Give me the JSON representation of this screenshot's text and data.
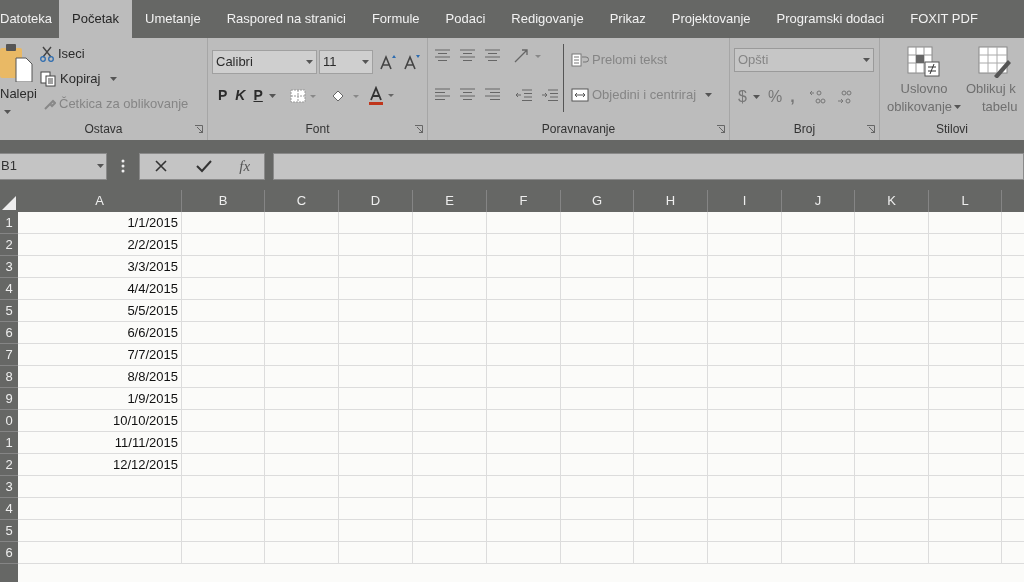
{
  "tabs": [
    {
      "label": "Datoteka",
      "selected": false
    },
    {
      "label": "Početak",
      "selected": true
    },
    {
      "label": "Umetanje",
      "selected": false
    },
    {
      "label": "Raspored na stranici",
      "selected": false
    },
    {
      "label": "Formule",
      "selected": false
    },
    {
      "label": "Podaci",
      "selected": false
    },
    {
      "label": "Redigovanje",
      "selected": false
    },
    {
      "label": "Prikaz",
      "selected": false
    },
    {
      "label": "Projektovanje",
      "selected": false
    },
    {
      "label": "Programski dodaci",
      "selected": false
    },
    {
      "label": "FOXIT PDF",
      "selected": false
    }
  ],
  "ribbon": {
    "clipboard": {
      "label": "Ostava",
      "paste": "Nalepi",
      "cut": {
        "label": "Iseci",
        "disabled": false
      },
      "copy": {
        "label": "Kopiraj",
        "disabled": false
      },
      "format_painter": {
        "label": "Četkica za oblikovanje",
        "disabled": true
      }
    },
    "font": {
      "label": "Font",
      "name": "Calibri",
      "size": "11",
      "bold": "P",
      "italic": "K",
      "underline": "P"
    },
    "alignment": {
      "label": "Poravnavanje",
      "wrap_text": {
        "label": "Prelomi tekst",
        "disabled": true
      },
      "merge": {
        "label": "Objedini i centriraj",
        "disabled": true
      }
    },
    "number": {
      "label": "Broj",
      "format": {
        "value": "Opšti",
        "disabled": true
      },
      "currency": "$",
      "percent": "%",
      "comma": ","
    },
    "styles": {
      "label": "Stilovi",
      "conditional": [
        "Uslovno",
        "oblikovanje"
      ],
      "format_table": [
        "Oblikuj k",
        "tabelu"
      ]
    }
  },
  "formula_bar": {
    "name_box": "B1",
    "function_label": "fx"
  },
  "sheet": {
    "columns": [
      "A",
      "B",
      "C",
      "D",
      "E",
      "F",
      "G",
      "H",
      "I",
      "J",
      "K",
      "L"
    ],
    "rows": [
      {
        "header": "1",
        "a": "1/1/2015"
      },
      {
        "header": "2",
        "a": "2/2/2015"
      },
      {
        "header": "3",
        "a": "3/3/2015"
      },
      {
        "header": "4",
        "a": "4/4/2015"
      },
      {
        "header": "5",
        "a": "5/5/2015"
      },
      {
        "header": "6",
        "a": "6/6/2015"
      },
      {
        "header": "7",
        "a": "7/7/2015"
      },
      {
        "header": "8",
        "a": "8/8/2015"
      },
      {
        "header": "9",
        "a": "1/9/2015"
      },
      {
        "header": "0",
        "a": "10/10/2015"
      },
      {
        "header": "1",
        "a": "11/11/2015"
      },
      {
        "header": "2",
        "a": "12/12/2015"
      },
      {
        "header": "3"
      },
      {
        "header": "4"
      },
      {
        "header": "5"
      },
      {
        "header": "6"
      }
    ]
  }
}
